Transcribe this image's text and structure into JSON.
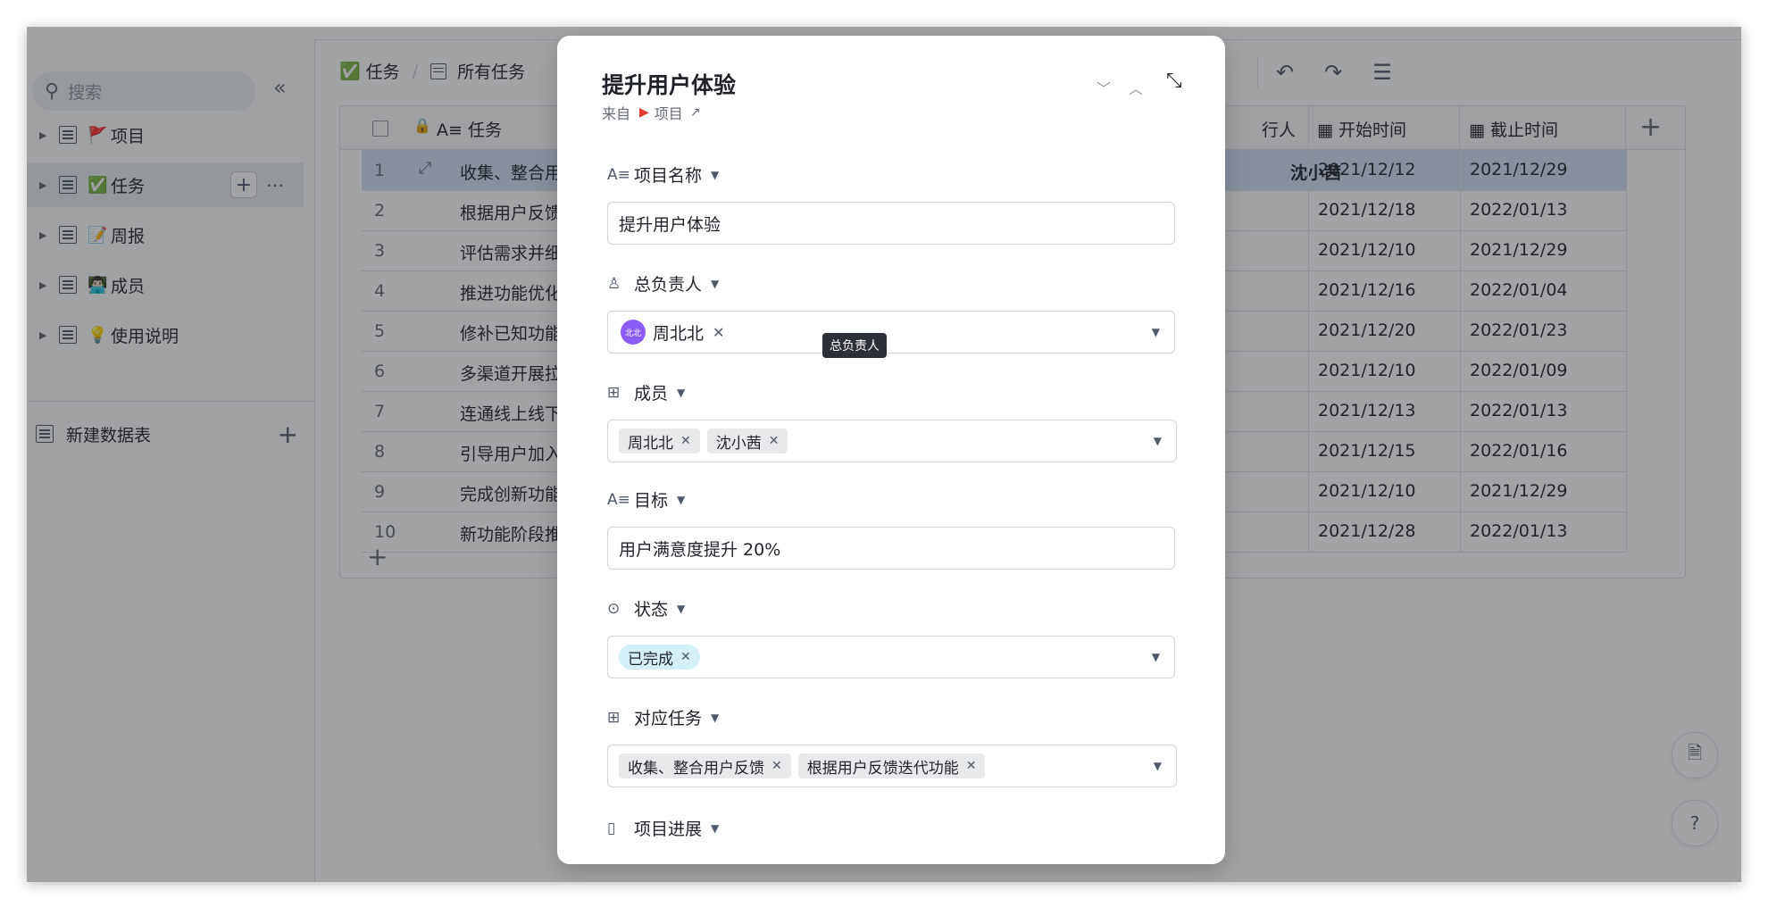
{
  "sidebar": {
    "search_placeholder": "搜索",
    "items": [
      {
        "emoji": "🚩",
        "label": "项目"
      },
      {
        "emoji": "✅",
        "label": "任务"
      },
      {
        "emoji": "📝",
        "label": "周报"
      },
      {
        "emoji": "👨🏻‍💻",
        "label": "成员"
      },
      {
        "emoji": "💡",
        "label": "使用说明"
      }
    ],
    "new_table": "新建数据表"
  },
  "toolbar": {
    "breadcrumb_table": "任务",
    "breadcrumb_view": "所有任务",
    "table_emoji": "✅"
  },
  "grid": {
    "headers": {
      "task": "任务",
      "owner_partial": "行人",
      "start": "开始时间",
      "end": "截止时间"
    },
    "rows": [
      {
        "num": "1",
        "title": "收集、整合用户",
        "owner": "沈小茜",
        "start": "2021/12/12",
        "end": "2021/12/29"
      },
      {
        "num": "2",
        "title": "根据用户反馈迭",
        "start": "2021/12/18",
        "end": "2022/01/13"
      },
      {
        "num": "3",
        "title": "评估需求并细分",
        "start": "2021/12/10",
        "end": "2021/12/29"
      },
      {
        "num": "4",
        "title": "推进功能优化研",
        "start": "2021/12/16",
        "end": "2022/01/04"
      },
      {
        "num": "5",
        "title": "修补已知功能漏",
        "start": "2021/12/20",
        "end": "2022/01/23"
      },
      {
        "num": "6",
        "title": "多渠道开展拉新",
        "start": "2021/12/10",
        "end": "2022/01/09"
      },
      {
        "num": "7",
        "title": "连通线上线下用",
        "start": "2021/12/13",
        "end": "2022/01/13"
      },
      {
        "num": "8",
        "title": "引导用户加入社",
        "start": "2021/12/15",
        "end": "2022/01/16"
      },
      {
        "num": "9",
        "title": "完成创新功能开",
        "start": "2021/12/10",
        "end": "2021/12/29"
      },
      {
        "num": "10",
        "title": "新功能阶段推广",
        "start": "2021/12/28",
        "end": "2022/01/13"
      }
    ]
  },
  "modal": {
    "title": "提升用户体验",
    "source_prefix": "来自",
    "source_table": "项目",
    "fields": {
      "name_label": "项目名称",
      "name_value": "提升用户体验",
      "owner_label": "总负责人",
      "owner_avatar": "北北",
      "owner_value": "周北北",
      "members_label": "成员",
      "members": [
        "周北北",
        "沈小茜"
      ],
      "goal_label": "目标",
      "goal_value": "用户满意度提升 20%",
      "status_label": "状态",
      "status_value": "已完成",
      "tasks_label": "对应任务",
      "tasks": [
        "收集、整合用户反馈",
        "根据用户反馈迭代功能"
      ],
      "progress_label": "项目进展"
    },
    "tooltip": "总负责人"
  },
  "colors": {
    "accent_avatar": "#8b5cf6",
    "status_chip": "#d2f0f5",
    "selected_row": "#d5def2"
  }
}
